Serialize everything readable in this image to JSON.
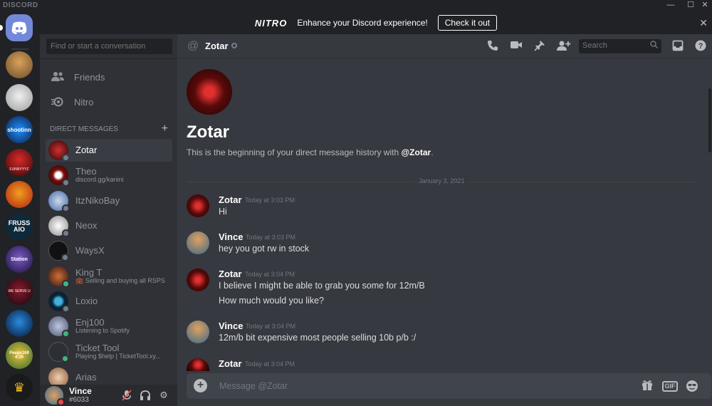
{
  "titlebar": {
    "brand": "DISCORD",
    "minimize": "—",
    "maximize": "☐",
    "close": "✕"
  },
  "banner": {
    "logo": "NITRO",
    "text": "Enhance your Discord experience!",
    "button": "Check it out",
    "close": "✕"
  },
  "rail": {
    "servers": [
      {
        "name": "Home",
        "icon": "discord-logo-icon"
      },
      {
        "label": ""
      },
      {
        "label": ""
      },
      {
        "label": "shootinn"
      },
      {
        "label": "FUNNYYYZ"
      },
      {
        "label": ""
      },
      {
        "label": "FRUSS AIO"
      },
      {
        "label": "Station"
      },
      {
        "label": "WE SERVE U"
      },
      {
        "label": ""
      },
      {
        "label": "Peeps169 4:20"
      },
      {
        "label": "GOLD"
      }
    ]
  },
  "sidebar": {
    "search_placeholder": "Find or start a conversation",
    "nav": [
      {
        "label": "Friends",
        "icon": "friends-icon"
      },
      {
        "label": "Nitro",
        "icon": "nitro-icon"
      }
    ],
    "dm_header": "DIRECT MESSAGES",
    "dm_add": "+",
    "dms": [
      {
        "name": "Zotar",
        "sub": "",
        "status": "offline",
        "active": true,
        "color": "#8b1a1a"
      },
      {
        "name": "Theo",
        "sub": "discord.gg/kanini",
        "status": "offline",
        "color": "#3a0d0d"
      },
      {
        "name": "ItzNikoBay",
        "sub": "",
        "status": "offline",
        "color": "#3e6aa8"
      },
      {
        "name": "Neox",
        "sub": "",
        "status": "offline",
        "color": "#cfcfcf"
      },
      {
        "name": "WaysX",
        "sub": "",
        "status": "offline",
        "color": "#111111"
      },
      {
        "name": "King T",
        "sub": "💼 Selling and buying all RSPS",
        "status": "online",
        "color": "#6b2a1a"
      },
      {
        "name": "Loxio",
        "sub": "",
        "status": "offline",
        "color": "#0b2233"
      },
      {
        "name": "Enj100",
        "sub": "Listening to Spotify",
        "status": "online",
        "color": "#7a86a8"
      },
      {
        "name": "Ticket Tool",
        "sub": "Playing $help | TicketTool.xy...",
        "status": "online",
        "color": "#2c2f33"
      },
      {
        "name": "Arias",
        "sub": "",
        "status": "offline",
        "color": "#caa57a"
      }
    ]
  },
  "user": {
    "name": "Vince",
    "tag": "#6033"
  },
  "header": {
    "at": "@",
    "name": "Zotar",
    "search_placeholder": "Search"
  },
  "intro": {
    "title": "Zotar",
    "text_prefix": "This is the beginning of your direct message history with ",
    "text_mention": "@Zotar",
    "text_suffix": "."
  },
  "divider_date": "January 3, 2021",
  "messages": [
    {
      "author": "Zotar",
      "time": "Today at 3:03 PM",
      "lines": [
        "Hi"
      ]
    },
    {
      "author": "Vince",
      "time": "Today at 3:03 PM",
      "lines": [
        "hey you got rw in stock"
      ]
    },
    {
      "author": "Zotar",
      "time": "Today at 3:04 PM",
      "lines": [
        "I believe I might be able to grab you some for 12m/B",
        "How much would you like?"
      ]
    },
    {
      "author": "Vince",
      "time": "Today at 3:04 PM",
      "lines": [
        "12m/b bit expensive most people selling 10b p/b :/"
      ]
    },
    {
      "author": "Zotar",
      "time": "Today at 3:04 PM",
      "lines": []
    }
  ],
  "composer": {
    "placeholder": "Message @Zotar",
    "add": "+",
    "gif": "GIF"
  },
  "colors": {
    "blurple": "#7289da",
    "online": "#43b581",
    "offline": "#747f8d",
    "background": "#36393f"
  }
}
